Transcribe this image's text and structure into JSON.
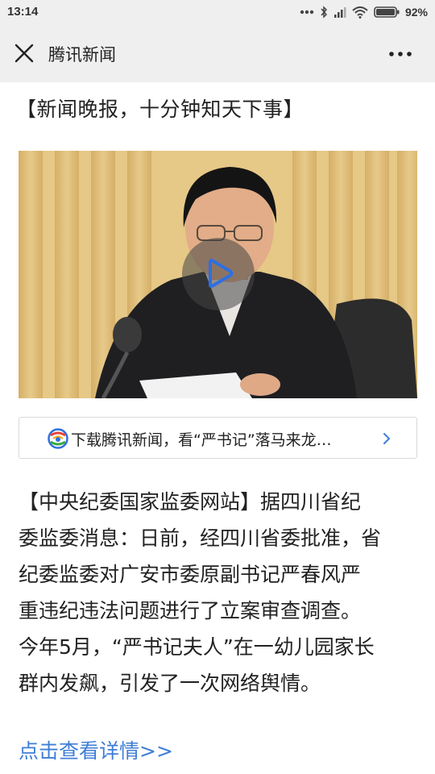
{
  "status_bar": {
    "time": "13:14",
    "battery_percent": "92%",
    "icons": [
      "dots-icon",
      "bluetooth-icon",
      "signal-icon",
      "wifi-icon",
      "battery-icon"
    ]
  },
  "nav": {
    "title": "腾讯新闻",
    "close_icon": "close-icon",
    "more_icon": "more-dots-icon"
  },
  "headline": "【新闻晚报，十分钟知天下事】",
  "video": {
    "play_icon": "play-icon"
  },
  "download_banner": {
    "text": "下载腾讯新闻，看“严书记”落马来龙…",
    "logo_icon": "tencent-news-logo-icon",
    "arrow_icon": "chevron-right-icon"
  },
  "article": {
    "lines": [
      "【中央纪委国家监委网站】据四川省纪",
      "委监委消息：日前，经四川省委批准，省",
      "纪委监委对广安市委原副书记严春风严",
      "重违纪违法问题进行了立案审查调查。",
      "今年5月，“严书记夫人”在一幼儿园家长",
      "群内发飙，引发了一次网络舆情。"
    ]
  },
  "more_link": "点击查看详情>>",
  "colors": {
    "link": "#3f7ed6",
    "play_accent": "#2f6fe0",
    "header_bg": "#efefef"
  }
}
